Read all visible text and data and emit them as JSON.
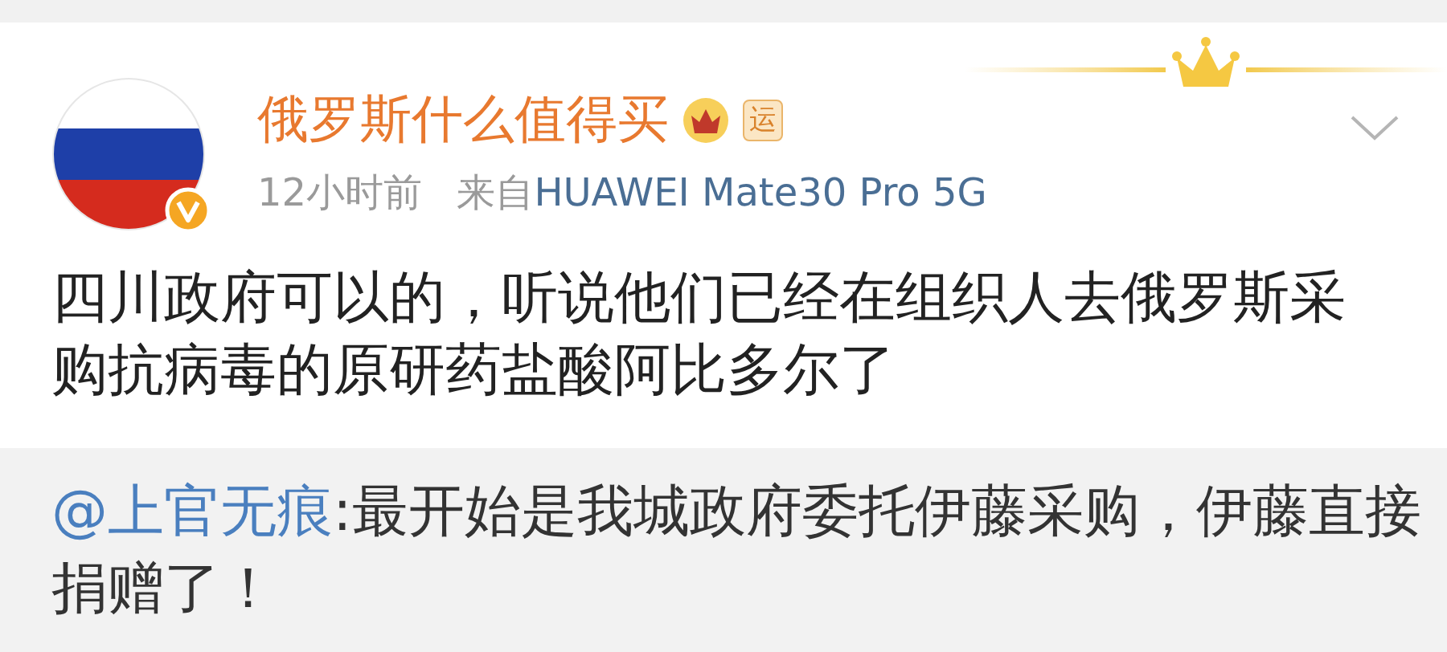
{
  "post": {
    "author": {
      "name": "俄罗斯什么值得买",
      "badge": "运",
      "verified": true
    },
    "time": "12小时前",
    "source_prefix": "来自",
    "source": "HUAWEI Mate30 Pro 5G",
    "text": "四川政府可以的，听说他们已经在组织人去俄罗斯采购抗病毒的原研药盐酸阿比多尔了"
  },
  "retweet": {
    "mention": "@上官无痕",
    "text": ":最开始是我城政府委托伊藤采购，伊藤直接捐赠了！"
  }
}
